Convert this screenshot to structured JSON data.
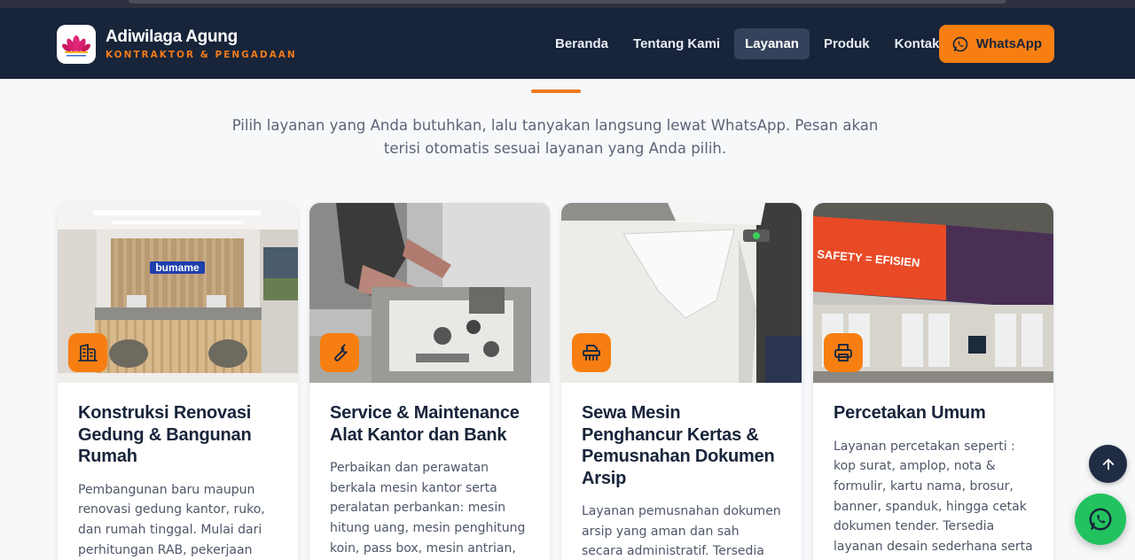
{
  "brand": {
    "name": "Adiwilaga Agung",
    "tagline": "KONTRAKTOR & PENGADAAN",
    "logo_icon": "lotus-logo"
  },
  "nav": {
    "items": [
      {
        "label": "Beranda",
        "active": false
      },
      {
        "label": "Tentang Kami",
        "active": false
      },
      {
        "label": "Layanan",
        "active": true
      },
      {
        "label": "Produk",
        "active": false
      },
      {
        "label": "Kontak",
        "active": false
      }
    ],
    "cta_label": "WhatsApp",
    "cta_icon": "whatsapp-icon"
  },
  "intro": {
    "line1": "Pilih layanan yang Anda butuhkan, lalu tanyakan langsung lewat WhatsApp. Pesan akan",
    "line2": "terisi otomatis sesuai layanan yang Anda pilih."
  },
  "cards": [
    {
      "title": "Konstruksi Renovasi Gedung & Bangunan Rumah",
      "description": "Pembangunan baru maupun renovasi gedung kantor, ruko, dan rumah tinggal. Mulai dari perhitungan RAB, pekerjaan",
      "icon": "building-icon",
      "image_sign": "bumame"
    },
    {
      "title": "Service & Maintenance Alat Kantor dan Bank",
      "description": "Perbaikan dan perawatan berkala mesin kantor serta peralatan perbankan: mesin hitung uang, mesin penghitung koin, pass box, mesin antrian, printer hingga",
      "icon": "wrench-icon"
    },
    {
      "title": "Sewa Mesin Penghancur Kertas & Pemusnahan Dokumen Arsip",
      "description": "Layanan pemusnahan dokumen arsip yang aman dan sah secara administratif. Tersedia sewa",
      "icon": "shredder-icon"
    },
    {
      "title": "Percetakan Umum",
      "description": "Layanan percetakan seperti : kop surat, amplop, nota & formulir, kartu nama, brosur, banner, spanduk, hingga cetak dokumen tender. Tersedia layanan desain sederhana serta pengerjaan",
      "icon": "printer-icon",
      "image_banner_text": "SAFETY = EFISIEN"
    }
  ],
  "floating": {
    "scroll_top_icon": "arrow-up-icon",
    "whatsapp_icon": "whatsapp-icon"
  },
  "colors": {
    "header_bg": "#17243a",
    "accent": "#f77f12",
    "whatsapp_green": "#22c35e"
  }
}
